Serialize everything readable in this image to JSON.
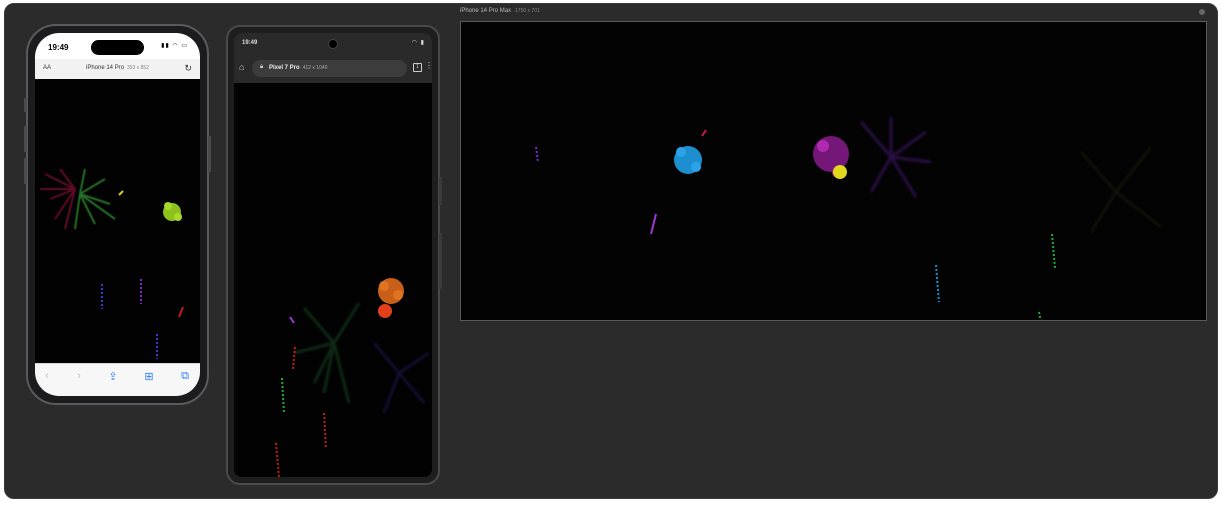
{
  "devices": {
    "iphone": {
      "time": "19:49",
      "text_size_label": "AA",
      "url_title": "iPhone 14 Pro",
      "url_size": "393 x 852",
      "reload_icon": "reload-icon",
      "toolbar": [
        "back-icon",
        "forward-icon",
        "share-icon",
        "bookmarks-icon",
        "tabs-icon"
      ]
    },
    "pixel": {
      "time": "19:49",
      "url_title": "Pixel 7 Pro",
      "url_size": "412 x 1040",
      "tabs_count": "1"
    },
    "desktop": {
      "label": "iPhone 14 Pro Max",
      "size": "1750 x 701"
    }
  },
  "colors": {
    "stage": "#2b2b2b",
    "accent_blue": "#2f7cf6"
  }
}
